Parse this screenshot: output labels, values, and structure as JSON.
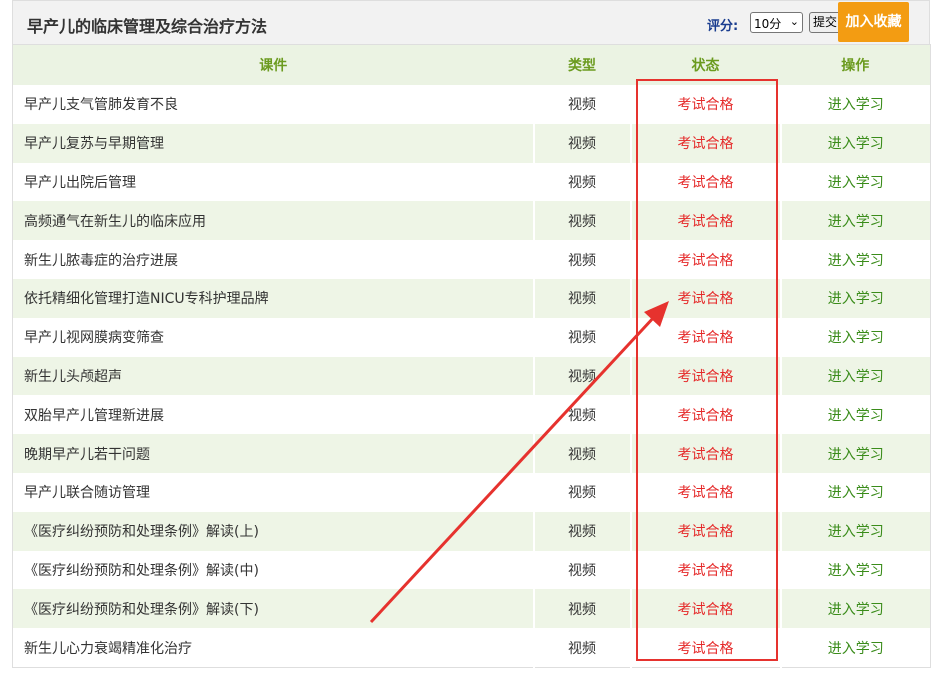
{
  "course_title": "早产儿的临床管理及综合治疗方法",
  "rating": {
    "label": "评分:",
    "selected": "10分",
    "submit_label": "提交"
  },
  "favorite_label": "加入收藏",
  "columns": {
    "name": "课件",
    "type": "类型",
    "status": "状态",
    "action": "操作"
  },
  "rows": [
    {
      "name": "早产儿支气管肺发育不良",
      "type": "视频",
      "status": "考试合格",
      "action": "进入学习"
    },
    {
      "name": "早产儿复苏与早期管理",
      "type": "视频",
      "status": "考试合格",
      "action": "进入学习"
    },
    {
      "name": "早产儿出院后管理",
      "type": "视频",
      "status": "考试合格",
      "action": "进入学习"
    },
    {
      "name": "高频通气在新生儿的临床应用",
      "type": "视频",
      "status": "考试合格",
      "action": "进入学习"
    },
    {
      "name": "新生儿脓毒症的治疗进展",
      "type": "视频",
      "status": "考试合格",
      "action": "进入学习"
    },
    {
      "name": "依托精细化管理打造NICU专科护理品牌",
      "type": "视频",
      "status": "考试合格",
      "action": "进入学习"
    },
    {
      "name": "早产儿视网膜病变筛查",
      "type": "视频",
      "status": "考试合格",
      "action": "进入学习"
    },
    {
      "name": "新生儿头颅超声",
      "type": "视频",
      "status": "考试合格",
      "action": "进入学习"
    },
    {
      "name": "双胎早产儿管理新进展",
      "type": "视频",
      "status": "考试合格",
      "action": "进入学习"
    },
    {
      "name": "晚期早产儿若干问题",
      "type": "视频",
      "status": "考试合格",
      "action": "进入学习"
    },
    {
      "name": "早产儿联合随访管理",
      "type": "视频",
      "status": "考试合格",
      "action": "进入学习"
    },
    {
      "name": "《医疗纠纷预防和处理条例》解读(上)",
      "type": "视频",
      "status": "考试合格",
      "action": "进入学习"
    },
    {
      "name": "《医疗纠纷预防和处理条例》解读(中)",
      "type": "视频",
      "status": "考试合格",
      "action": "进入学习"
    },
    {
      "name": "《医疗纠纷预防和处理条例》解读(下)",
      "type": "视频",
      "status": "考试合格",
      "action": "进入学习"
    },
    {
      "name": "新生儿心力衰竭精准化治疗",
      "type": "视频",
      "status": "考试合格",
      "action": "进入学习"
    }
  ],
  "colors": {
    "status_text": "#e52a2a",
    "action_text": "#3a8c1a",
    "header_text": "#6b9b1f",
    "annotation": "#e6322e",
    "favorite_bg": "#f39c12"
  },
  "icons": {
    "select_caret": "chevron-down-icon"
  }
}
